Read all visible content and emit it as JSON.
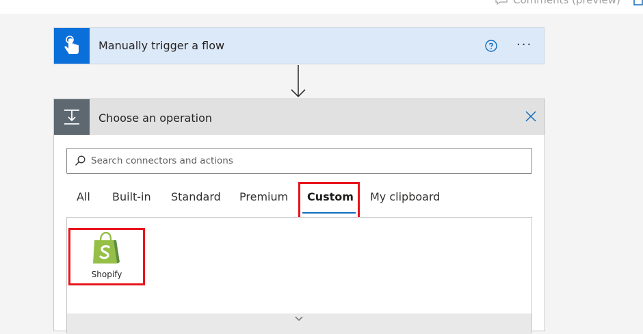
{
  "topbar": {
    "comments_label": "Comments (preview)"
  },
  "trigger": {
    "title": "Manually trigger a flow",
    "more_label": "···"
  },
  "operation": {
    "title": "Choose an operation",
    "search": {
      "value": "",
      "placeholder": "Search connectors and actions"
    },
    "tabs": [
      {
        "label": "All"
      },
      {
        "label": "Built-in"
      },
      {
        "label": "Standard"
      },
      {
        "label": "Premium"
      },
      {
        "label": "Custom",
        "active": true
      },
      {
        "label": "My clipboard"
      }
    ],
    "connectors": [
      {
        "label": "Shopify",
        "icon": "shopify-bag-icon"
      }
    ]
  },
  "colors": {
    "trigger_icon_bg": "#0a6fd9",
    "trigger_bg": "#dce9f8",
    "operation_icon_bg": "#5d6870",
    "highlight": "#e8141c",
    "active_tab_underline": "#0f6cbd",
    "shopify_green": "#95bf47"
  }
}
